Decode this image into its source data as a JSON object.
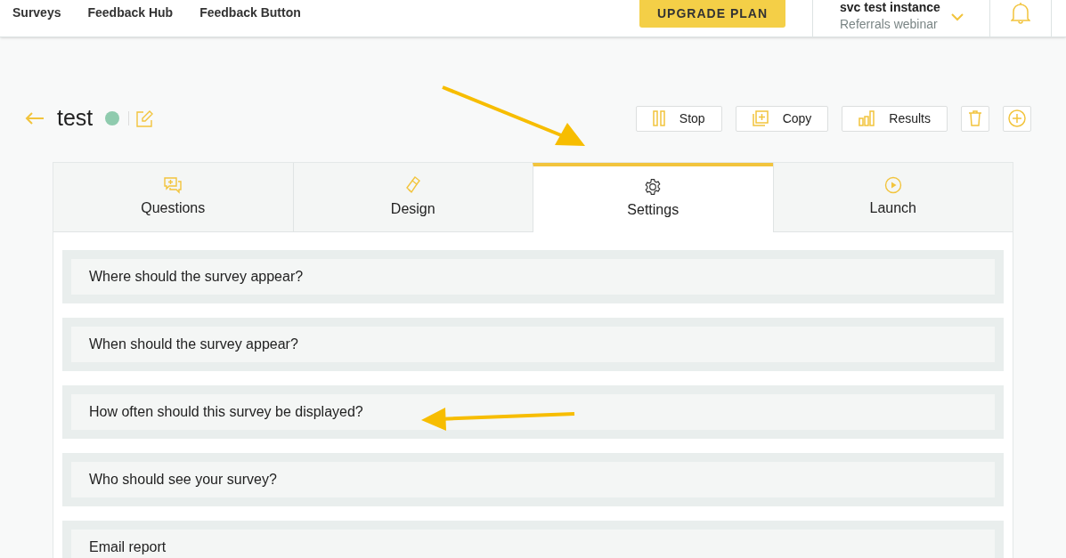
{
  "nav": {
    "items": [
      "Surveys",
      "Feedback Hub",
      "Feedback Button"
    ],
    "upgrade": "UPGRADE PLAN",
    "account": {
      "name": "svc test instance",
      "project": "Referrals webinar"
    }
  },
  "survey": {
    "title": "test",
    "active": true,
    "actions": [
      {
        "kind": "stop",
        "label": "Stop"
      },
      {
        "kind": "copy",
        "label": "Copy"
      },
      {
        "kind": "results",
        "label": "Results"
      },
      {
        "kind": "delete"
      },
      {
        "kind": "add"
      }
    ]
  },
  "tabs": [
    {
      "kind": "questions",
      "label": "Questions",
      "selected": false
    },
    {
      "kind": "design",
      "label": "Design",
      "selected": false
    },
    {
      "kind": "settings",
      "label": "Settings",
      "selected": true
    },
    {
      "kind": "launch",
      "label": "Launch",
      "selected": false
    }
  ],
  "sections": [
    "Where should the survey appear?",
    "When should the survey appear?",
    "How often should this survey be displayed?",
    "Who should see your survey?",
    "Email report"
  ]
}
